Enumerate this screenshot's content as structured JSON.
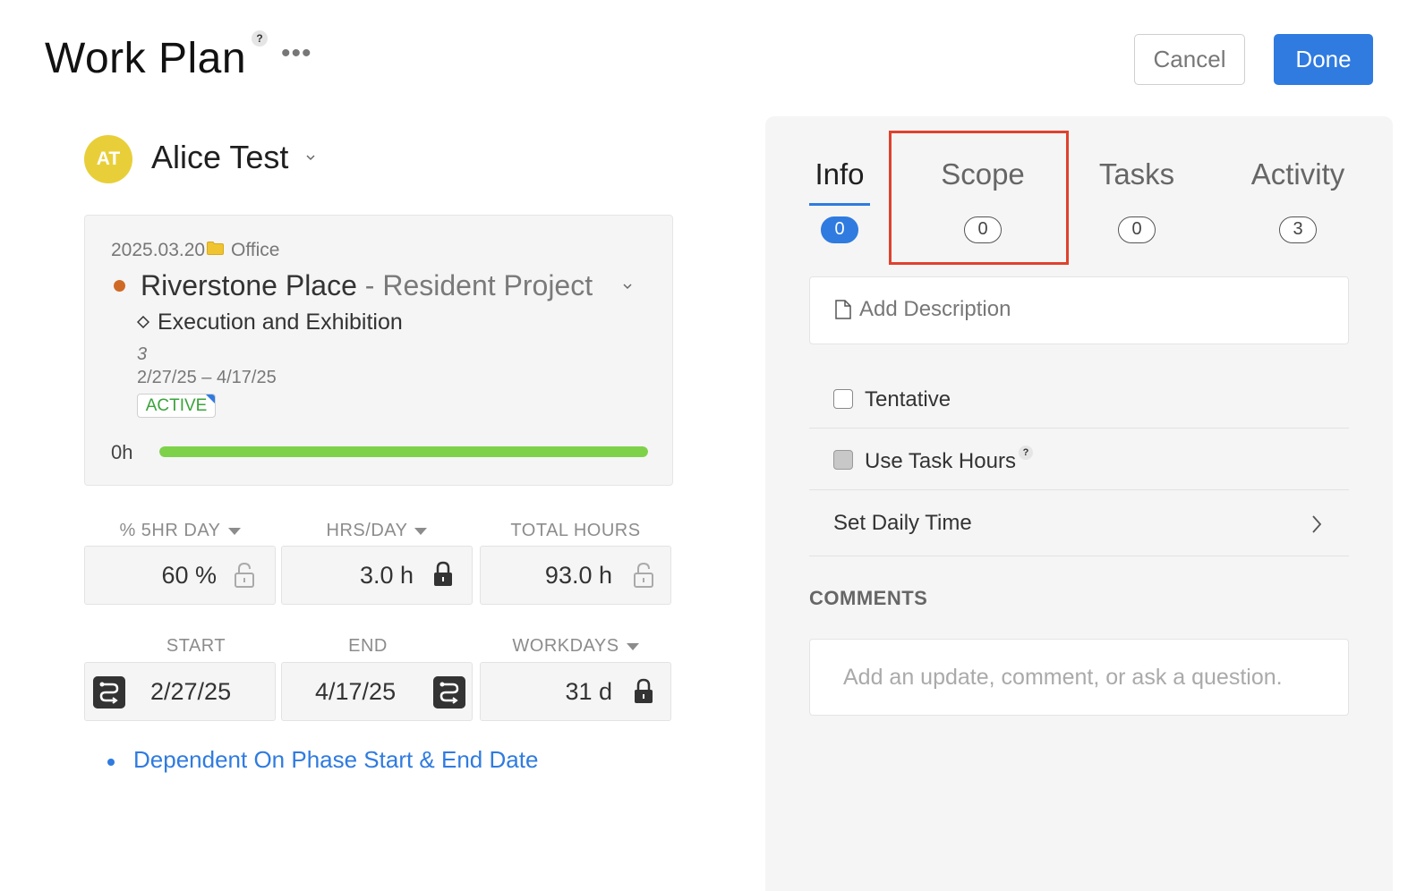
{
  "header": {
    "title": "Work Plan",
    "help_glyph": "?",
    "more_glyph": "•••",
    "cancel_label": "Cancel",
    "done_label": "Done"
  },
  "member": {
    "initials": "AT",
    "name": "Alice Test",
    "avatar_color": "#e8cf3a"
  },
  "project": {
    "date": "2025.03.20",
    "folder": "Office",
    "name": "Riverstone Place",
    "separator": "-",
    "subtitle": "Resident Project",
    "dot_color": "#cf6a25",
    "phase": "Execution and Exhibition",
    "phase_number": "3",
    "date_range": "2/27/25 – 4/17/25",
    "status": "ACTIVE",
    "hours_label": "0h",
    "progress_percent": 100
  },
  "metrics": {
    "pct_label": "% 5HR DAY",
    "pct_value": "60 %",
    "hrs_label": "HRS/DAY",
    "hrs_value": "3.0 h",
    "total_label": "TOTAL HOURS",
    "total_value": "93.0 h",
    "start_label": "START",
    "start_value": "2/27/25",
    "end_label": "END",
    "end_value": "4/17/25",
    "workdays_label": "WORKDAYS",
    "workdays_value": "31 d"
  },
  "dependency_link": "Dependent On Phase Start & End Date",
  "tabs": [
    {
      "label": "Info",
      "count": "0",
      "active": true
    },
    {
      "label": "Scope",
      "count": "0",
      "active": false
    },
    {
      "label": "Tasks",
      "count": "0",
      "active": false
    },
    {
      "label": "Activity",
      "count": "3",
      "active": false
    }
  ],
  "info": {
    "description_placeholder": "Add Description",
    "tentative_label": "Tentative",
    "use_task_hours_label": "Use Task Hours",
    "set_daily_time_label": "Set Daily Time",
    "comments_title": "COMMENTS",
    "comment_placeholder": "Add an update, comment, or ask a question."
  },
  "colors": {
    "accent": "#2f7be0",
    "highlight": "#e0412e",
    "progress": "#7ed24a",
    "status_text": "#3aa33a"
  }
}
